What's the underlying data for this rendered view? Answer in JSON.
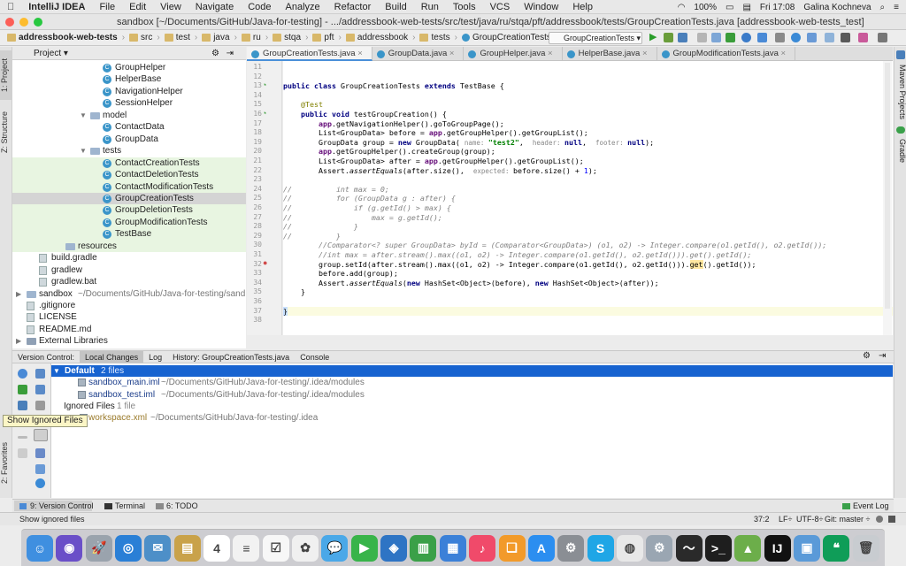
{
  "menubar": {
    "app_name": "IntelliJ IDEA",
    "items": [
      "File",
      "Edit",
      "View",
      "Navigate",
      "Code",
      "Analyze",
      "Refactor",
      "Build",
      "Run",
      "Tools",
      "VCS",
      "Window",
      "Help"
    ],
    "battery": "100%",
    "clock": "Fri 17:08",
    "user": "Galina Kochneva"
  },
  "window": {
    "title": "sandbox [~/Documents/GitHub/Java-for-testing] - .../addressbook-web-tests/src/test/java/ru/stqa/pft/addressbook/tests/GroupCreationTests.java [addressbook-web-tests_test]"
  },
  "breadcrumbs": [
    "addressbook-web-tests",
    "src",
    "test",
    "java",
    "ru",
    "stqa",
    "pft",
    "addressbook",
    "tests",
    "GroupCreationTests"
  ],
  "run_config": "GroupCreationTests",
  "project_panel": {
    "title": "Project",
    "tree": [
      {
        "label": "GroupHelper",
        "kind": "class",
        "indent": 102
      },
      {
        "label": "HelperBase",
        "kind": "class",
        "indent": 102
      },
      {
        "label": "NavigationHelper",
        "kind": "class",
        "indent": 102
      },
      {
        "label": "SessionHelper",
        "kind": "class",
        "indent": 102
      },
      {
        "label": "model",
        "kind": "folder",
        "indent": 88,
        "arrow": "▼"
      },
      {
        "label": "ContactData",
        "kind": "class",
        "indent": 102
      },
      {
        "label": "GroupData",
        "kind": "class",
        "indent": 102
      },
      {
        "label": "tests",
        "kind": "folder",
        "indent": 88,
        "arrow": "▼"
      },
      {
        "label": "ContactCreationTests",
        "kind": "class",
        "indent": 102,
        "green": true
      },
      {
        "label": "ContactDeletionTests",
        "kind": "class",
        "indent": 102,
        "green": true
      },
      {
        "label": "ContactModificationTests",
        "kind": "class",
        "indent": 102,
        "green": true
      },
      {
        "label": "GroupCreationTests",
        "kind": "class",
        "indent": 102,
        "selected": true
      },
      {
        "label": "GroupDeletionTests",
        "kind": "class",
        "indent": 102,
        "green": true
      },
      {
        "label": "GroupModificationTests",
        "kind": "class",
        "indent": 102,
        "green": true
      },
      {
        "label": "TestBase",
        "kind": "class",
        "indent": 102,
        "green": true
      },
      {
        "label": "resources",
        "kind": "folder",
        "indent": 60,
        "green": true
      },
      {
        "label": "build.gradle",
        "kind": "file",
        "indent": 30
      },
      {
        "label": "gradlew",
        "kind": "file",
        "indent": 30
      },
      {
        "label": "gradlew.bat",
        "kind": "file",
        "indent": 30
      },
      {
        "label": "sandbox",
        "kind": "folder",
        "indent": 16,
        "arrow": "▶",
        "path": "~/Documents/GitHub/Java-for-testing/sand"
      },
      {
        "label": ".gitignore",
        "kind": "file",
        "indent": 16
      },
      {
        "label": "LICENSE",
        "kind": "file",
        "indent": 16
      },
      {
        "label": "README.md",
        "kind": "file",
        "indent": 16
      },
      {
        "label": "External Libraries",
        "kind": "lib",
        "indent": 16,
        "arrow": "▶"
      }
    ]
  },
  "editor": {
    "tabs": [
      "GroupCreationTests.java",
      "GroupData.java",
      "GroupHelper.java",
      "HelperBase.java",
      "GroupModificationTests.java"
    ],
    "active_tab": 0,
    "lines": [
      {
        "n": "11",
        "html": ""
      },
      {
        "n": "12",
        "html": ""
      },
      {
        "n": "13",
        "html": "<span class=\"kw\">public class</span> GroupCreationTests <span class=\"kw\">extends</span> TestBase {"
      },
      {
        "n": "14",
        "html": ""
      },
      {
        "n": "15",
        "html": "    <span class=\"an\">@Test</span>"
      },
      {
        "n": "16",
        "html": "    <span class=\"kw\">public void</span> testGroupCreation() {"
      },
      {
        "n": "17",
        "html": "        <span class=\"fn\">app</span>.getNavigationHelper().goToGroupPage();"
      },
      {
        "n": "18",
        "html": "        List&lt;GroupData&gt; before = <span class=\"fn\">app</span>.getGroupHelper().getGroupList();"
      },
      {
        "n": "19",
        "html": "        GroupData group = <span class=\"kw\">new</span> GroupData( <span class=\"hint\">name: </span><span class=\"st\">\"test2\"</span>,  <span class=\"hint\">header: </span><span class=\"kw\">null</span>,  <span class=\"hint\">footer: </span><span class=\"kw\">null</span>);"
      },
      {
        "n": "20",
        "html": "        <span class=\"fn\">app</span>.getGroupHelper().createGroup(group);"
      },
      {
        "n": "21",
        "html": "        List&lt;GroupData&gt; after = <span class=\"fn\">app</span>.getGroupHelper().getGroupList();"
      },
      {
        "n": "22",
        "html": "        Assert.<span class=\"it\">assertEquals</span>(after.size(),  <span class=\"hint\">expected: </span>before.size() + <span style=\"color:#0000ff\">1</span>);"
      },
      {
        "n": "23",
        "html": ""
      },
      {
        "n": "24",
        "html": "<span class=\"cm\">//          int max = 0;</span>"
      },
      {
        "n": "25",
        "html": "<span class=\"cm\">//          for (GroupData g : after) {</span>"
      },
      {
        "n": "26",
        "html": "<span class=\"cm\">//              if (g.getId() &gt; max) {</span>"
      },
      {
        "n": "27",
        "html": "<span class=\"cm\">//                  max = g.getId();</span>"
      },
      {
        "n": "28",
        "html": "<span class=\"cm\">//              }</span>"
      },
      {
        "n": "29",
        "html": "<span class=\"cm\">//          }</span>"
      },
      {
        "n": "30",
        "html": "        <span class=\"cm\">//Comparator&lt;? super GroupData&gt; byId = (Comparator&lt;GroupData&gt;) (o1, o2) -&gt; Integer.compare(o1.getId(), o2.getId());</span>"
      },
      {
        "n": "31",
        "html": "        <span class=\"cm\">//int max = after.stream().max((o1, o2) -&gt; Integer.compare(o1.getId(), o2.getId())).get().getId();</span>"
      },
      {
        "n": "32",
        "html": "        group.setId(after.stream().max((o1, o2) -&gt; Integer.compare(o1.getId(), o2.getId())).<span style=\"background:#ffe8a0\">get</span>().getId());"
      },
      {
        "n": "33",
        "html": "        before.add(group);"
      },
      {
        "n": "34",
        "html": "        Assert.<span class=\"it\">assertEquals</span>(<span class=\"kw\">new</span> HashSet&lt;Object&gt;(before), <span class=\"kw\">new</span> HashSet&lt;Object&gt;(after));"
      },
      {
        "n": "35",
        "html": "    }"
      },
      {
        "n": "36",
        "html": ""
      },
      {
        "n": "37",
        "html": "<span style=\"background:#c8e0ff\">}</span>"
      },
      {
        "n": "38",
        "html": ""
      }
    ],
    "current_line_index": 26
  },
  "version_control": {
    "tabs": [
      "Version Control:",
      "Local Changes",
      "Log",
      "History: GroupCreationTests.java",
      "Console"
    ],
    "active_tab": 1,
    "rows": [
      {
        "label": "Default",
        "count": "2 files",
        "kind": "group",
        "selected": true
      },
      {
        "label": "sandbox_main.iml",
        "path": "~/Documents/GitHub/Java-for-testing/.idea/modules",
        "kind": "file"
      },
      {
        "label": "sandbox_test.iml",
        "path": "~/Documents/GitHub/Java-for-testing/.idea/modules",
        "kind": "file"
      },
      {
        "label": "Ignored Files",
        "count": "1 file",
        "kind": "group"
      },
      {
        "label": "workspace.xml",
        "path": "~/Documents/GitHub/Java-for-testing/.idea",
        "kind": "file-ignored"
      }
    ],
    "tooltip": "Show Ignored Files"
  },
  "left_stripe": {
    "project_tab": "1: Project",
    "structure_tab": "Z: Structure",
    "favorites_tab": "2: Favorites"
  },
  "right_stripe": {
    "maven_tab": "Maven Projects",
    "gradle_tab": "Gradle"
  },
  "tool_buttons": {
    "version_control": "9: Version Control",
    "terminal": "Terminal",
    "todo": "6: TODO",
    "event_log": "Event Log"
  },
  "status": {
    "message": "Show ignored files",
    "position": "37:2",
    "line_sep": "LF÷",
    "encoding": "UTF-8÷",
    "git": "Git: master ÷"
  },
  "dock_apps": [
    {
      "name": "finder",
      "color": "#3f8fe0",
      "glyph": "☺"
    },
    {
      "name": "siri",
      "color": "#6a4fc8",
      "glyph": "◉"
    },
    {
      "name": "launchpad",
      "color": "#9aa3ad",
      "glyph": "🚀"
    },
    {
      "name": "safari",
      "color": "#2a7fd6",
      "glyph": "◎"
    },
    {
      "name": "mail",
      "color": "#4d8fc8",
      "glyph": "✉"
    },
    {
      "name": "notes-app",
      "color": "#c9a24a",
      "glyph": "▤"
    },
    {
      "name": "calendar",
      "color": "#ffffff",
      "glyph": "4"
    },
    {
      "name": "notes",
      "color": "#f2f2f2",
      "glyph": "≡"
    },
    {
      "name": "reminders",
      "color": "#f7f7f7",
      "glyph": "☑"
    },
    {
      "name": "photos",
      "color": "#f0f0f0",
      "glyph": "✿"
    },
    {
      "name": "messages",
      "color": "#4aa8e8",
      "glyph": "💬"
    },
    {
      "name": "facetime",
      "color": "#38b44a",
      "glyph": "▶"
    },
    {
      "name": "keynote",
      "color": "#2e74c4",
      "glyph": "◈"
    },
    {
      "name": "numbers",
      "color": "#3aa048",
      "glyph": "▥"
    },
    {
      "name": "keynote2",
      "color": "#3b80d8",
      "glyph": "▦"
    },
    {
      "name": "music",
      "color": "#f04a6a",
      "glyph": "♪"
    },
    {
      "name": "books",
      "color": "#f29a2a",
      "glyph": "❑"
    },
    {
      "name": "app-store",
      "color": "#2b8ef0",
      "glyph": "A"
    },
    {
      "name": "system-preferences",
      "color": "#8a8e94",
      "glyph": "⚙"
    },
    {
      "name": "skype",
      "color": "#1fa6e6",
      "glyph": "S"
    },
    {
      "name": "chrome",
      "color": "#e8e8e8",
      "glyph": "◍"
    },
    {
      "name": "utility",
      "color": "#9aa6b2",
      "glyph": "⚙"
    },
    {
      "name": "activity-monitor",
      "color": "#2a2a2a",
      "glyph": "〜"
    },
    {
      "name": "terminal",
      "color": "#1e1e1e",
      "glyph": ">_"
    },
    {
      "name": "android-studio",
      "color": "#6cae4a",
      "glyph": "▲"
    },
    {
      "name": "intellij-idea",
      "color": "#111111",
      "glyph": "IJ"
    },
    {
      "name": "preview",
      "color": "#5a9ad8",
      "glyph": "▣"
    },
    {
      "name": "hangouts",
      "color": "#0f9d58",
      "glyph": "❝"
    },
    {
      "name": "trash",
      "color": "#c8ccd0",
      "glyph": "🗑"
    }
  ],
  "colors": {
    "selection": "#1763d0",
    "accent": "#4a90d9",
    "test_green": "#e8f5e1"
  }
}
